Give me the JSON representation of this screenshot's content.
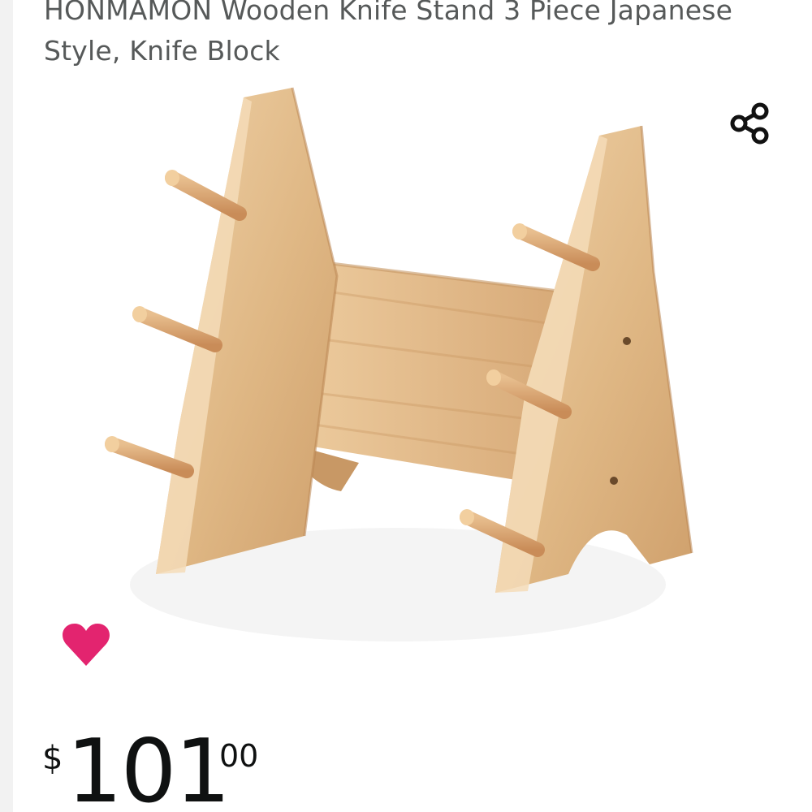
{
  "product": {
    "title": "HONMAMON Wooden Knife Stand 3 Piece Japanese Style, Knife Block",
    "image_alt": "Wooden knife stand with pegs"
  },
  "actions": {
    "share_icon": "share-icon",
    "wishlist_icon": "heart-icon",
    "wishlist_color": "#e3246f"
  },
  "price": {
    "symbol": "$",
    "whole": "101",
    "fraction": "00"
  }
}
